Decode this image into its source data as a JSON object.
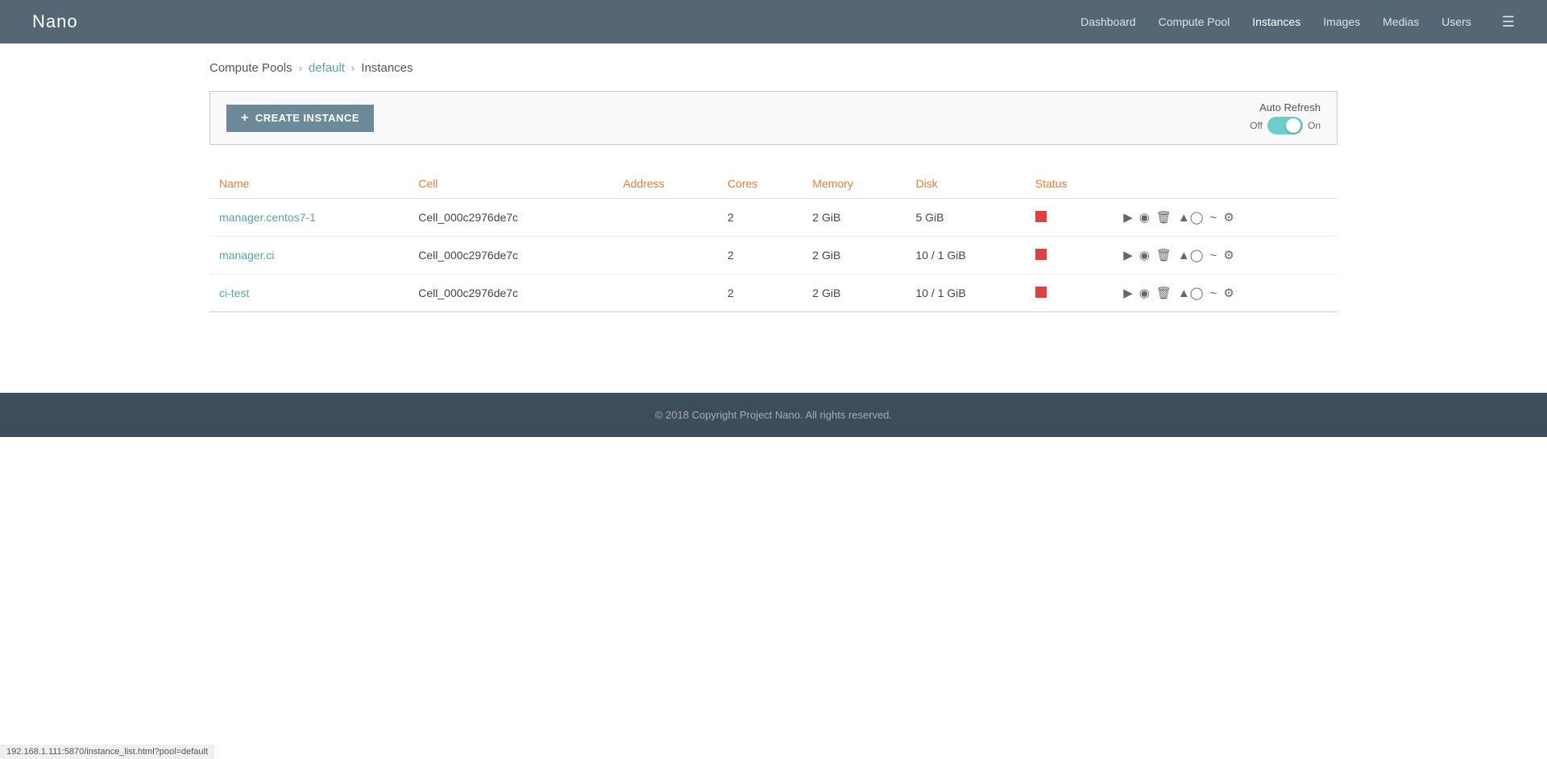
{
  "header": {
    "logo": "Nano",
    "nav": [
      {
        "label": "Dashboard",
        "active": false
      },
      {
        "label": "Compute Pool",
        "active": false
      },
      {
        "label": "Instances",
        "active": true
      },
      {
        "label": "Images",
        "active": false
      },
      {
        "label": "Medias",
        "active": false
      },
      {
        "label": "Users",
        "active": false
      }
    ]
  },
  "breadcrumb": {
    "computePools": "Compute Pools",
    "default": "default",
    "instances": "Instances"
  },
  "toolbar": {
    "createButton": "CREATE INSTANCE",
    "plus": "+",
    "autoRefreshLabel": "Auto Refresh",
    "off": "Off",
    "on": "On"
  },
  "table": {
    "columns": [
      "Name",
      "Cell",
      "Address",
      "Cores",
      "Memory",
      "Disk",
      "Status"
    ],
    "rows": [
      {
        "name": "manager.centos7-1",
        "cell": "Cell_000c2976de7c",
        "address": "",
        "cores": "2",
        "memory": "2 GiB",
        "disk": "5 GiB",
        "status": "red"
      },
      {
        "name": "manager.ci",
        "cell": "Cell_000c2976de7c",
        "address": "",
        "cores": "2",
        "memory": "2 GiB",
        "disk": "10 / 1 GiB",
        "status": "red"
      },
      {
        "name": "ci-test",
        "cell": "Cell_000c2976de7c",
        "address": "",
        "cores": "2",
        "memory": "2 GiB",
        "disk": "10 / 1 GiB",
        "status": "red"
      }
    ]
  },
  "footer": {
    "text": "© 2018 Copyright Project Nano. All rights reserved."
  },
  "statusBar": {
    "url": "192.168.1.111:5870/instance_list.html?pool=default"
  }
}
